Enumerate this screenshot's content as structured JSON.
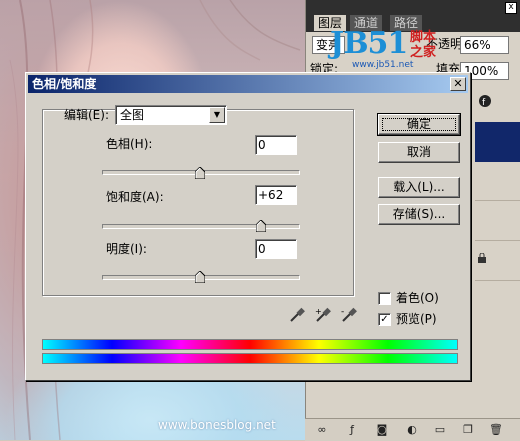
{
  "dialog": {
    "title": "色相/饱和度",
    "close_glyph": "✕",
    "edit_label": "编辑(E):",
    "edit_value": "全图",
    "hue": {
      "label": "色相(H):",
      "value": "0",
      "level": 0.5
    },
    "saturation": {
      "label": "饱和度(A):",
      "value": "+62",
      "level": 0.81
    },
    "lightness": {
      "label": "明度(I):",
      "value": "0",
      "level": 0.5
    },
    "buttons": {
      "ok": "确定",
      "cancel": "取消",
      "load": "载入(L)...",
      "save": "存储(S)..."
    },
    "colorize_label": "着色(O)",
    "colorize_checked": false,
    "preview_label": "预览(P)",
    "preview_checked": true,
    "check_glyph": "✓",
    "eyedroppers": [
      "eyedropper-icon",
      "eyedropper-plus-icon",
      "eyedropper-minus-icon"
    ]
  },
  "right_panel": {
    "tabs": [
      "图层",
      "通道",
      "路径"
    ],
    "blend_mode": "变亮",
    "opacity_label": "不透明度:",
    "opacity_value": "66%",
    "lock_label": "锁定:",
    "fill_label": "填充:",
    "fill_value": "100%",
    "close_glyph": "x"
  },
  "watermark": {
    "main": "JB51",
    "cn_top": "脚本",
    "cn_bottom": "之家",
    "url": "www.jb51.net"
  },
  "site_watermark": "www.bonesblog.net",
  "colors": {
    "titlebar_start": "#0a246a",
    "titlebar_end": "#a6caf0",
    "dialog_face": "#d4d0c8",
    "accent_navy": "#11276a"
  }
}
